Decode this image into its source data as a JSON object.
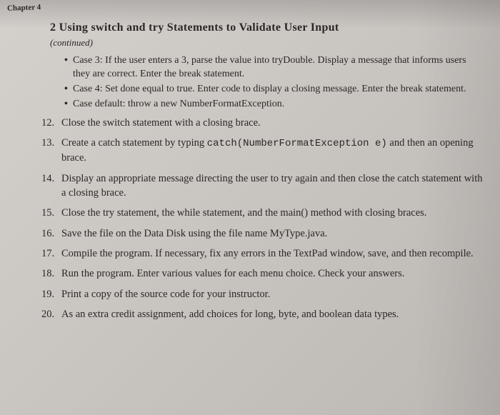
{
  "header": {
    "chapter": "Chapter 4"
  },
  "section": {
    "title": "2 Using switch and try Statements to Validate User Input",
    "continued": "(continued)"
  },
  "bullets": [
    "Case 3: If the user enters a 3, parse the value into tryDouble. Display a message that informs users they are correct. Enter the break statement.",
    "Case 4: Set done equal to true. Enter code to display a closing message. Enter the break statement.",
    "Case default: throw a new NumberFormatException."
  ],
  "items": [
    {
      "n": "12.",
      "text": "Close the switch statement with a closing brace."
    },
    {
      "n": "13.",
      "text_before": "Create a catch statement by typing ",
      "code": "catch(NumberFormatException e)",
      "text_after": " and then an opening brace."
    },
    {
      "n": "14.",
      "text": "Display an appropriate message directing the user to try again and then close the catch statement with a closing brace."
    },
    {
      "n": "15.",
      "text": "Close the try statement, the while statement, and the main() method with closing braces."
    },
    {
      "n": "16.",
      "text": "Save the file on the Data Disk using the file name MyType.java."
    },
    {
      "n": "17.",
      "text": "Compile the program. If necessary, fix any errors in the TextPad window, save, and then recompile."
    },
    {
      "n": "18.",
      "text": "Run the program. Enter various values for each menu choice. Check your answers."
    },
    {
      "n": "19.",
      "text": "Print a copy of the source code for your instructor."
    },
    {
      "n": "20.",
      "text": "As an extra credit assignment, add choices for long, byte, and boolean data types."
    }
  ]
}
